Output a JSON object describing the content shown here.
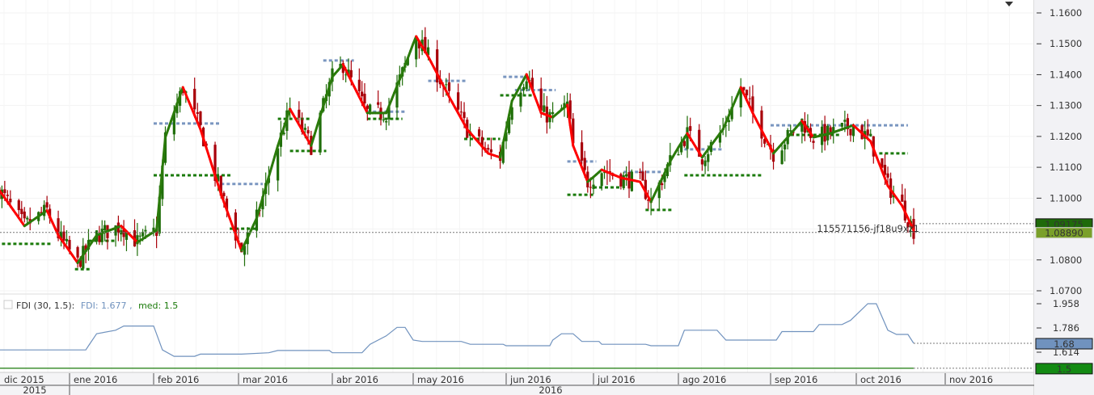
{
  "chart_data": {
    "type": "candlestick",
    "x_axis": {
      "month_labels": [
        "dic 2015",
        "ene 2016",
        "feb 2016",
        "mar 2016",
        "abr 2016",
        "may 2016",
        "jun 2016",
        "jul 2016",
        "ago 2016",
        "sep 2016",
        "oct 2016",
        "nov 2016"
      ],
      "year_labels": [
        "2015",
        "2016"
      ]
    },
    "main_panel": {
      "y_ticks": [
        "1.1600",
        "1.1500",
        "1.1400",
        "1.1300",
        "1.1200",
        "1.1100",
        "1.1000",
        "1.0900",
        "1.0800",
        "1.0700"
      ],
      "ylim": [
        1.07,
        1.16
      ],
      "grid": true,
      "colors": {
        "up": "#1f6e0a",
        "down": "#a8000a",
        "trend_up": "#2a7a0a",
        "trend_down": "#ff0000",
        "resistance": "#7a96c0",
        "support": "#1a7a0a"
      },
      "trend_line": [
        [
          "2015-12-07",
          1.1027
        ],
        [
          "2015-12-16",
          1.091
        ],
        [
          "2015-12-24",
          1.096
        ],
        [
          "2015-12-28",
          1.088
        ],
        [
          "2016-01-04",
          1.079
        ],
        [
          "2016-01-11",
          1.088
        ],
        [
          "2016-01-20",
          1.091
        ],
        [
          "2016-01-26",
          1.0857
        ],
        [
          "2016-02-02",
          1.0896
        ],
        [
          "2016-02-05",
          1.1197
        ],
        [
          "2016-02-11",
          1.1359
        ],
        [
          "2016-02-17",
          1.1223
        ],
        [
          "2016-02-24",
          1.1014
        ],
        [
          "2016-03-02",
          1.083
        ],
        [
          "2016-03-07",
          1.0935
        ],
        [
          "2016-03-14",
          1.117
        ],
        [
          "2016-03-18",
          1.1289
        ],
        [
          "2016-03-25",
          1.117
        ],
        [
          "2016-04-01",
          1.1393
        ],
        [
          "2016-04-05",
          1.1433
        ],
        [
          "2016-04-08",
          1.138
        ],
        [
          "2016-04-14",
          1.1276
        ],
        [
          "2016-04-21",
          1.1276
        ],
        [
          "2016-04-27",
          1.1406
        ],
        [
          "2016-05-02",
          1.1524
        ],
        [
          "2016-05-06",
          1.1459
        ],
        [
          "2016-05-13",
          1.1328
        ],
        [
          "2016-05-19",
          1.1223
        ],
        [
          "2016-05-26",
          1.1145
        ],
        [
          "2016-05-30",
          1.1132
        ],
        [
          "2016-06-03",
          1.1315
        ],
        [
          "2016-06-08",
          1.1401
        ],
        [
          "2016-06-13",
          1.1276
        ],
        [
          "2016-06-17",
          1.1262
        ],
        [
          "2016-06-22",
          1.1302
        ],
        [
          "2016-06-24",
          1.117
        ],
        [
          "2016-06-29",
          1.1053
        ],
        [
          "2016-07-04",
          1.1092
        ],
        [
          "2016-07-11",
          1.1066
        ],
        [
          "2016-07-18",
          1.1053
        ],
        [
          "2016-07-22",
          1.0988
        ],
        [
          "2016-07-29",
          1.1119
        ],
        [
          "2016-08-04",
          1.121
        ],
        [
          "2016-08-09",
          1.1132
        ],
        [
          "2016-08-16",
          1.1223
        ],
        [
          "2016-08-22",
          1.1359
        ],
        [
          "2016-08-26",
          1.1276
        ],
        [
          "2016-09-02",
          1.1145
        ],
        [
          "2016-09-12",
          1.125
        ],
        [
          "2016-09-16",
          1.1197
        ],
        [
          "2016-09-22",
          1.121
        ],
        [
          "2016-09-30",
          1.1236
        ],
        [
          "2016-10-06",
          1.1184
        ],
        [
          "2016-10-12",
          1.104
        ],
        [
          "2016-10-17",
          1.0975
        ],
        [
          "2016-10-21",
          1.0896
        ]
      ],
      "resistance_levels": [
        [
          "2016-02-01",
          "2016-02-24",
          1.1242
        ],
        [
          "2016-02-24",
          "2016-03-09",
          1.1046
        ],
        [
          "2016-03-29",
          "2016-04-09",
          1.1446
        ],
        [
          "2016-04-14",
          "2016-04-28",
          1.128
        ],
        [
          "2016-05-06",
          "2016-05-19",
          1.138
        ],
        [
          "2016-05-31",
          "2016-06-07",
          1.1393
        ],
        [
          "2016-06-04",
          "2016-06-18",
          1.135
        ],
        [
          "2016-06-22",
          "2016-07-02",
          1.1119
        ],
        [
          "2016-07-12",
          "2016-07-26",
          1.1085
        ],
        [
          "2016-08-03",
          "2016-08-16",
          1.1158
        ],
        [
          "2016-09-01",
          "2016-10-19",
          1.1236
        ]
      ],
      "support_levels": [
        [
          "2015-12-01",
          "2015-12-07",
          1.0797
        ],
        [
          "2015-12-08",
          "2015-12-26",
          1.0852
        ],
        [
          "2016-01-03",
          "2016-01-09",
          1.077
        ],
        [
          "2016-01-08",
          "2016-01-18",
          1.0862
        ],
        [
          "2016-02-01",
          "2016-02-28",
          1.1074
        ],
        [
          "2016-02-27",
          "2016-03-07",
          1.0901
        ],
        [
          "2016-03-14",
          "2016-03-25",
          1.1257
        ],
        [
          "2016-03-18",
          "2016-03-30",
          1.1153
        ],
        [
          "2016-04-14",
          "2016-04-27",
          1.1257
        ],
        [
          "2016-05-18",
          "2016-05-30",
          1.1192
        ],
        [
          "2016-05-30",
          "2016-06-10",
          1.1333
        ],
        [
          "2016-06-22",
          "2016-07-01",
          1.1011
        ],
        [
          "2016-07-01",
          "2016-07-11",
          1.1035
        ],
        [
          "2016-07-20",
          "2016-07-30",
          1.0962
        ],
        [
          "2016-08-03",
          "2016-08-29",
          1.1074
        ],
        [
          "2016-09-08",
          "2016-09-25",
          1.1205
        ],
        [
          "2016-10-09",
          "2016-10-19",
          1.1145
        ]
      ],
      "price_tags": [
        {
          "value": "1.09175",
          "price": 1.09175,
          "color": "#1f6a0a"
        },
        {
          "value": "1.08890",
          "price": 1.0889,
          "color": "#7aa02a"
        }
      ],
      "annotation": "115571156-jf18u9xz1"
    },
    "fdi_panel": {
      "legend": {
        "prefix": "FDI (30, 1.5):",
        "fdi_label": "FDI: 1.677",
        "sep": ",",
        "med_label": "med: 1.5"
      },
      "y_ticks": [
        "1.958",
        "1.786",
        "1.614"
      ],
      "fdi_color": "#7092be",
      "med_color": "#1a7a0a",
      "median": 1.5,
      "fdi_series": [
        [
          "2015-12-07",
          1.63
        ],
        [
          "2016-01-07",
          1.63
        ],
        [
          "2016-01-08",
          1.66
        ],
        [
          "2016-01-11",
          1.745
        ],
        [
          "2016-01-18",
          1.77
        ],
        [
          "2016-01-21",
          1.8
        ],
        [
          "2016-02-01",
          1.8
        ],
        [
          "2016-02-04",
          1.63
        ],
        [
          "2016-02-08",
          1.585
        ],
        [
          "2016-02-15",
          1.585
        ],
        [
          "2016-02-17",
          1.6
        ],
        [
          "2016-03-02",
          1.6
        ],
        [
          "2016-03-11",
          1.61
        ],
        [
          "2016-03-14",
          1.626
        ],
        [
          "2016-03-31",
          1.626
        ],
        [
          "2016-04-01",
          1.61
        ],
        [
          "2016-04-12",
          1.61
        ],
        [
          "2016-04-13",
          1.63
        ],
        [
          "2016-04-15",
          1.67
        ],
        [
          "2016-04-21",
          1.73
        ],
        [
          "2016-04-25",
          1.79
        ],
        [
          "2016-04-28",
          1.79
        ],
        [
          "2016-05-01",
          1.7
        ],
        [
          "2016-05-04",
          1.69
        ],
        [
          "2016-05-17",
          1.69
        ],
        [
          "2016-05-20",
          1.67
        ],
        [
          "2016-05-31",
          1.67
        ],
        [
          "2016-06-01",
          1.66
        ],
        [
          "2016-06-16",
          1.66
        ],
        [
          "2016-06-17",
          1.7
        ],
        [
          "2016-06-20",
          1.745
        ],
        [
          "2016-06-24",
          1.745
        ],
        [
          "2016-06-27",
          1.69
        ],
        [
          "2016-07-03",
          1.69
        ],
        [
          "2016-07-04",
          1.67
        ],
        [
          "2016-07-20",
          1.67
        ],
        [
          "2016-07-22",
          1.66
        ],
        [
          "2016-08-01",
          1.66
        ],
        [
          "2016-08-03",
          1.77
        ],
        [
          "2016-08-14",
          1.77
        ],
        [
          "2016-08-17",
          1.7
        ],
        [
          "2016-09-03",
          1.7
        ],
        [
          "2016-09-05",
          1.76
        ],
        [
          "2016-09-16",
          1.76
        ],
        [
          "2016-09-18",
          1.81
        ],
        [
          "2016-09-26",
          1.81
        ],
        [
          "2016-09-29",
          1.84
        ],
        [
          "2016-10-05",
          1.958
        ],
        [
          "2016-10-08",
          1.958
        ],
        [
          "2016-10-12",
          1.77
        ],
        [
          "2016-10-15",
          1.74
        ],
        [
          "2016-10-19",
          1.74
        ],
        [
          "2016-10-21",
          1.677
        ]
      ],
      "tags": [
        {
          "value": "1.68",
          "level": 1.677,
          "color": "#7092be"
        },
        {
          "value": "1.5",
          "level": 1.5,
          "color": "#138a13"
        }
      ]
    }
  }
}
